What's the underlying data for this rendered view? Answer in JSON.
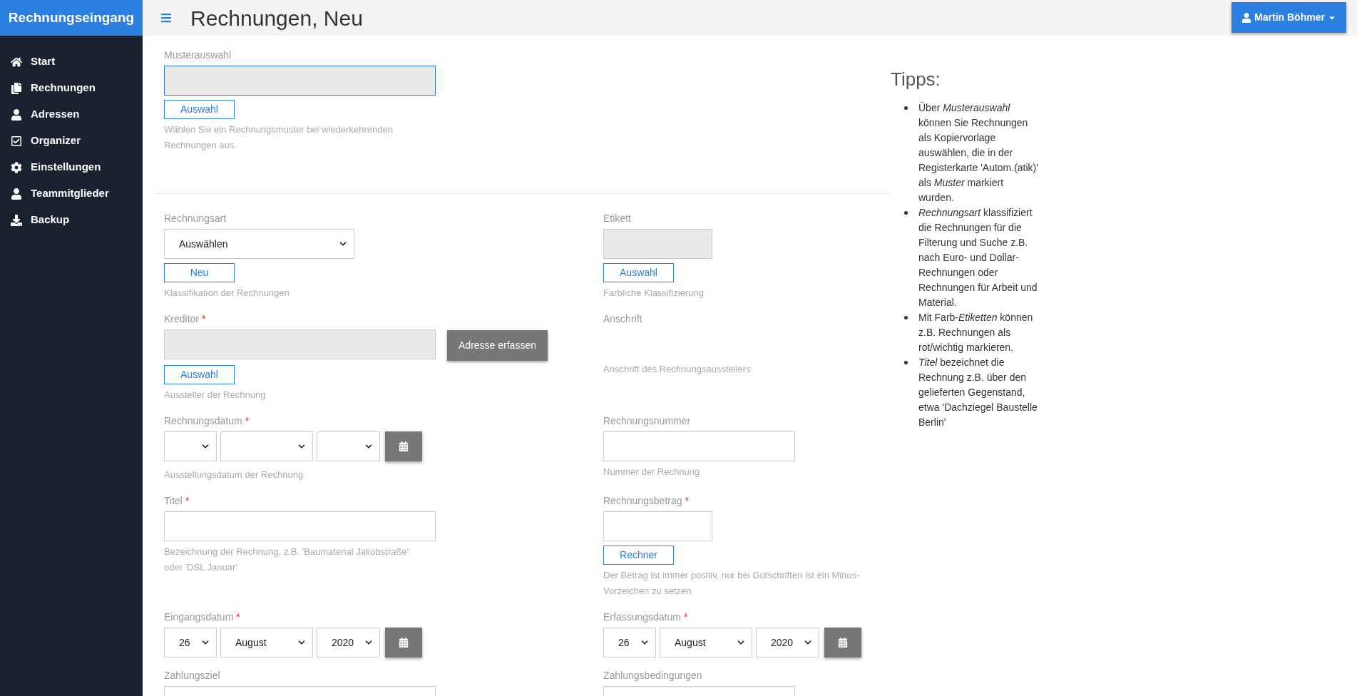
{
  "brand": "Rechnungseingang",
  "sidebar": {
    "items": [
      {
        "label": "Start"
      },
      {
        "label": "Rechnungen"
      },
      {
        "label": "Adressen"
      },
      {
        "label": "Organizer"
      },
      {
        "label": "Einstellungen"
      },
      {
        "label": "Teammitglieder"
      },
      {
        "label": "Backup"
      }
    ]
  },
  "header": {
    "title": "Rechnungen, Neu",
    "user": "Martin Böhmer"
  },
  "template": {
    "label": "Musterauswahl",
    "control": {
      "kind": "wide_input",
      "readonly": true,
      "focused": true
    },
    "button": "Auswahl",
    "help": "Wählen Sie ein Rechnungsmuster bei wiederkehrenden Rechnungen aus."
  },
  "rows": [
    {
      "left": {
        "label": "Rechnungsart",
        "control": {
          "kind": "select",
          "value": "Auswählen"
        },
        "button": "Neu",
        "help": "Klassifikation der Rechnungen"
      },
      "right": {
        "label": "Etikett",
        "control": {
          "kind": "short_input",
          "readonly": true
        },
        "button": "Auswahl",
        "help": "Farbliche Klassifizierung"
      }
    },
    {
      "left": {
        "label": "Kreditor",
        "required_mark": "*",
        "control": {
          "kind": "wide_input",
          "readonly": true
        },
        "side_button": "Adresse erfassen",
        "button": "Auswahl",
        "help": "Aussteller der Rechnung"
      },
      "right": {
        "label": "Anschrift",
        "help": "Anschrift des Rechnungsausstellers"
      }
    },
    {
      "left": {
        "label": "Rechnungsdatum",
        "required_mark": "*",
        "control": {
          "kind": "date"
        },
        "help": "Ausstellungsdatum der Rechnung"
      },
      "right": {
        "label": "Rechnungsnummer",
        "control": {
          "kind": "medium_input"
        },
        "help": "Nummer der Rechnung"
      }
    },
    {
      "left": {
        "label": "Titel",
        "required_mark": "*",
        "control": {
          "kind": "wide_input"
        },
        "help": "Bezeichnung der Rechnung, z.B. 'Baumaterial Jakobstraße' oder 'DSL Januar'"
      },
      "right": {
        "label": "Rechnungsbetrag",
        "required_mark": "*",
        "control": {
          "kind": "short_input"
        },
        "button": "Rechner",
        "help": "Der Betrag ist immer positiv, nur bei Gutschriften ist ein Minus-Vorzeichen zu setzen"
      }
    },
    {
      "left": {
        "label": "Eingangsdatum",
        "required_mark": "*",
        "control": {
          "kind": "date",
          "day": "26",
          "month": "August",
          "year": "2020"
        }
      },
      "right": {
        "label": "Erfassungsdatum",
        "required_mark": "*",
        "control": {
          "kind": "date",
          "day": "26",
          "month": "August",
          "year": "2020"
        }
      }
    },
    {
      "left": {
        "label": "Zahlungsziel",
        "control": {
          "kind": "wide_input"
        }
      },
      "right": {
        "label": "Zahlungsbedingungen",
        "control": {
          "kind": "medium_input"
        }
      }
    }
  ],
  "tips": {
    "title": "Tipps:",
    "items": [
      "Über *Musterauswahl* können Sie Rechnungen als Kopiervorlage auswählen, die in der Registerkarte 'Autom.(atik)' als *Muster* markiert wurden.",
      "*Rechnungsart* klassifiziert die Rechnungen für die Filterung und Suche z.B. nach Euro- und Dollar-Rechnungen oder Rechnungen für Arbeit und Material.",
      "Mit Farb-*Etiketten* können z.B. Rechnungen als rot/wichtig markieren.",
      "*Titel* bezeichnet die Rechnung z.B. über den gelieferten Gegenstand, etwa 'Dachziegel Baustelle Berlin'"
    ]
  }
}
